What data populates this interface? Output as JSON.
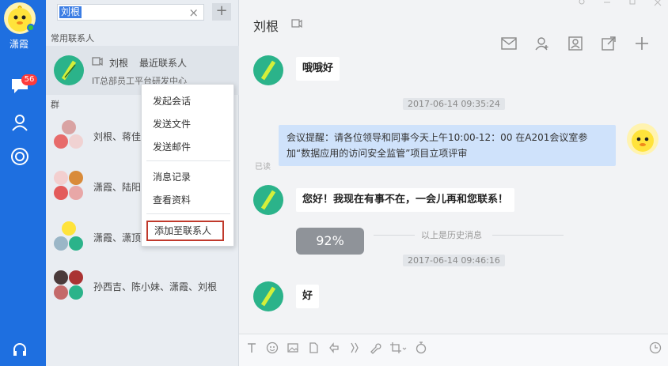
{
  "profile": {
    "name": "潇霞",
    "unread_badge": "56"
  },
  "search": {
    "query": "刘根",
    "clear_label": "×",
    "add_label": "+"
  },
  "contacts": {
    "frequent_label": "常用联系人",
    "recent": {
      "name": "刘根",
      "tag": "最近联系人",
      "subtitle": "IT总部员工平台研发中心"
    },
    "groups_label": "群",
    "groups": [
      {
        "name": "刘根、蒋佳"
      },
      {
        "name": "潇霞、陆阳"
      },
      {
        "name": "潇霞、潇顶"
      },
      {
        "name": "孙西吉、陈小妹、潇霞、刘根"
      }
    ]
  },
  "context_menu": {
    "items": [
      "发起会话",
      "发送文件",
      "发送邮件",
      "消息记录",
      "查看资料"
    ],
    "highlighted": "添加至联系人"
  },
  "chat": {
    "title": "刘根",
    "messages": {
      "m1": "哦哦好",
      "ts1": "2017-06-14 09:35:24",
      "m2": "会议提醒：请各位领导和同事今天上午10:00-12：00 在A201会议室参加“数据应用的访问安全监管”项目立项评审",
      "read_flag": "已读",
      "m3": "您好！我现在有事不在，一会儿再和您联系！",
      "progress": "92%",
      "history": "以上是历史消息",
      "ts2": "2017-06-14 09:46:16",
      "m4": "好"
    }
  },
  "colors": {
    "nav_bg": "#1e6fe0",
    "accent_red": "#c0392b",
    "bubble_self": "#cfe2fb"
  }
}
